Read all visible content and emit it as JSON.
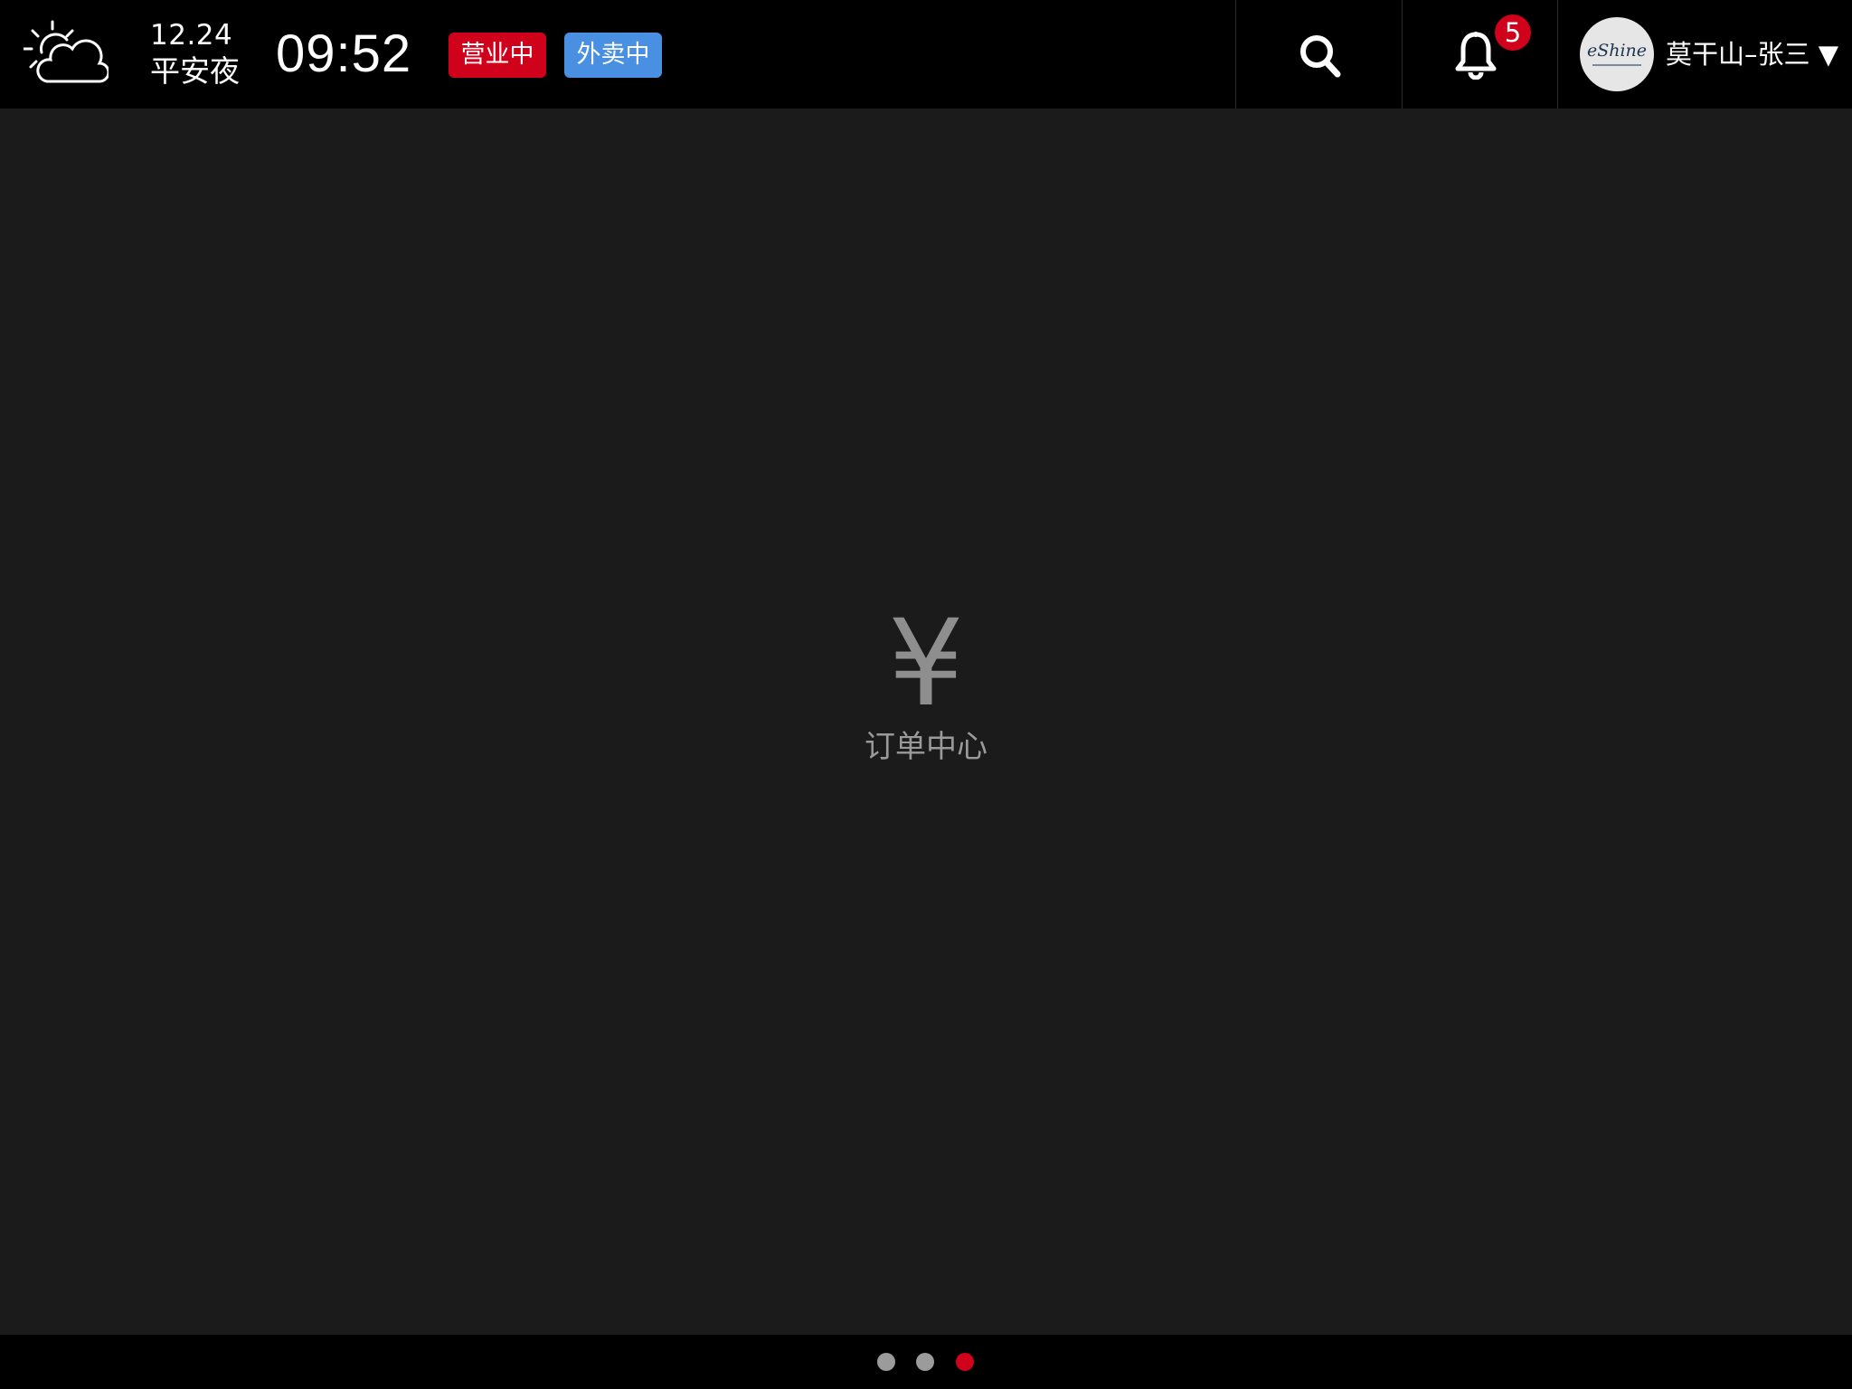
{
  "header": {
    "date": "12.24",
    "holiday": "平安夜",
    "time": "09:52",
    "status_open": "营业中",
    "status_delivery": "外卖中",
    "notification_count": "5",
    "avatar_logo_text": "eShine",
    "user_label": "莫干山–张三 ▼",
    "weather_icon": "partly-cloudy-icon",
    "colors": {
      "open": "#d0021b",
      "delivery": "#4a90e2",
      "badge": "#d0021b"
    }
  },
  "main": {
    "icon_glyph": "¥",
    "label": "订单中心"
  },
  "pager": {
    "total": 3,
    "active_index": 2,
    "colors": {
      "inactive": "#9b9b9b",
      "active": "#d0021b"
    }
  }
}
